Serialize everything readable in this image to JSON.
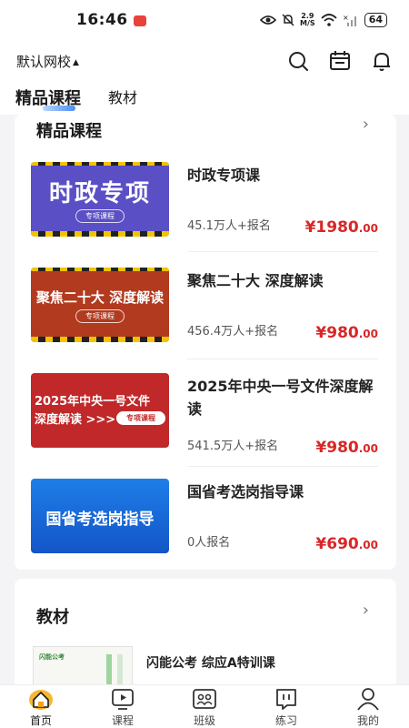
{
  "status": {
    "time": "16:46",
    "net_speed_top": "2.9",
    "net_speed_bottom": "M/S",
    "battery": "64"
  },
  "header": {
    "school": "默认网校",
    "icons": [
      "search-icon",
      "calendar-icon",
      "bell-icon"
    ]
  },
  "tabs": [
    {
      "label": "精品课程",
      "active": true
    },
    {
      "label": "教材",
      "active": false
    }
  ],
  "courses_section": {
    "title": "精品课程",
    "more": "›",
    "items": [
      {
        "name": "时政专项课",
        "thumb_title": "时政专项",
        "thumb_tag": "专项课程",
        "signup": "45.1万人+报名",
        "price_int": "¥1980",
        "price_dec": ".00"
      },
      {
        "name": "聚焦二十大 深度解读",
        "thumb_title": "聚焦二十大 深度解读",
        "thumb_tag": "专项课程",
        "signup": "456.4万人+报名",
        "price_int": "¥980",
        "price_dec": ".00"
      },
      {
        "name": "2025年中央一号文件深度解读",
        "thumb_title": "2025年中央一号文件",
        "thumb_title2": "深度解读 >>>",
        "thumb_tag": "专项课程",
        "signup": "541.5万人+报名",
        "price_int": "¥980",
        "price_dec": ".00"
      },
      {
        "name": "国省考选岗指导课",
        "thumb_title": "国省考选岗指导",
        "signup": "0人报名",
        "price_int": "¥690",
        "price_dec": ".00"
      }
    ]
  },
  "textbooks_section": {
    "title": "教材",
    "more": "›",
    "items": [
      {
        "name": "闪能公考 综应A特训课",
        "thumb_brand": "闪能公考"
      }
    ]
  },
  "bottom_nav": [
    {
      "label": "首页",
      "icon": "home-icon",
      "active": true
    },
    {
      "label": "课程",
      "icon": "play-icon",
      "active": false
    },
    {
      "label": "班级",
      "icon": "class-icon",
      "active": false
    },
    {
      "label": "练习",
      "icon": "exercise-icon",
      "active": false
    },
    {
      "label": "我的",
      "icon": "profile-icon",
      "active": false
    }
  ],
  "colors": {
    "price": "#d92626",
    "tab_underline": "#4b8ff2",
    "home_active": "#f0a41a"
  }
}
